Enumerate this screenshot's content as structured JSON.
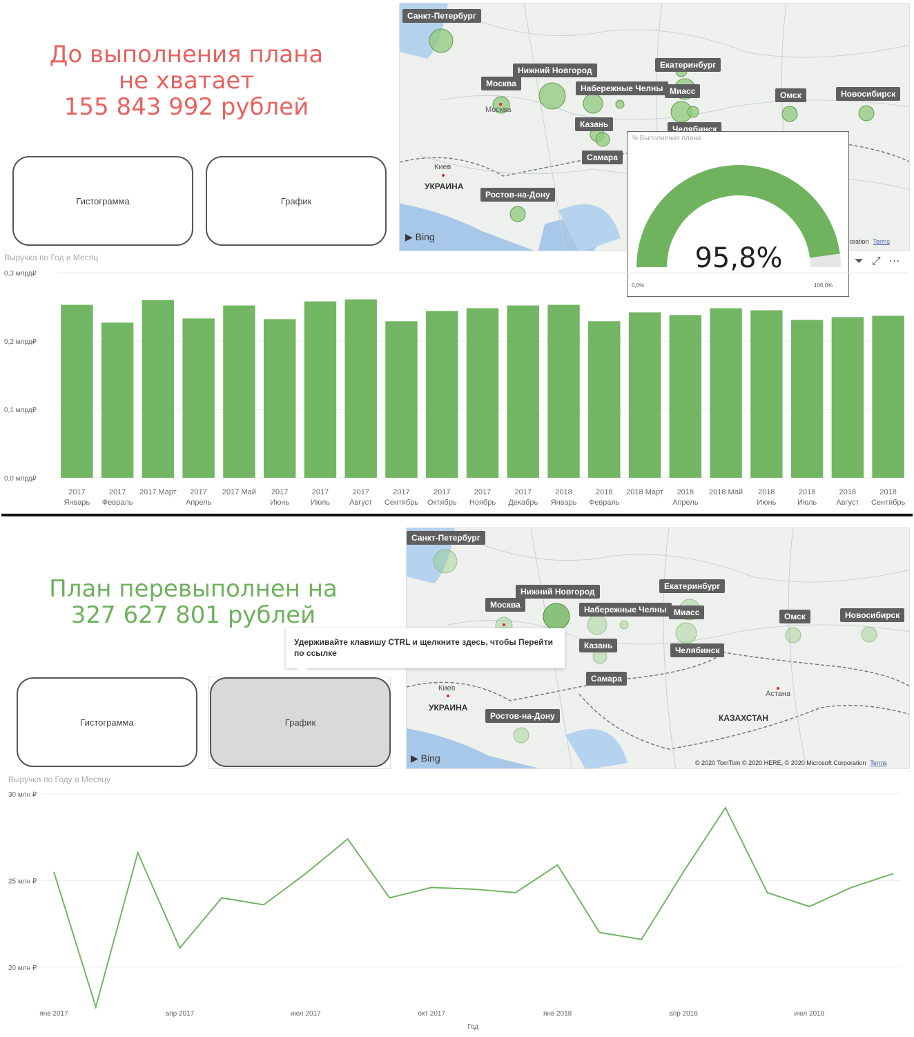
{
  "top": {
    "headline": "До выполнения плана\nне хватает\n    155 843 992 рублей",
    "buttons": [
      "Гистограмма",
      "График"
    ],
    "map": {
      "cities": [
        "Санкт-Петербург",
        "Москва",
        "Нижний Новгород",
        "Набережные Челны",
        "Екатеринбург",
        "Миасс",
        "Омск",
        "Новосибирск",
        "Казань",
        "Челябинск",
        "Самара",
        "Ростов-на-Дону"
      ],
      "country": "УКРАИНА",
      "places": [
        "Москва",
        "Киев"
      ],
      "bing": "Bing",
      "copyright": "oration",
      "terms": "Terms"
    },
    "gauge": {
      "title": "% Выполнения плана",
      "value_text": "95,8%",
      "fraction": 0.958,
      "min_label": "0,0%",
      "max_label": "100,0%",
      "fill_color": "#6fb35f",
      "track_color": "#e6e6e6"
    },
    "bar_chart": {
      "title": "Выручка по Год и Месяц",
      "chart_data": {
        "type": "bar",
        "ylim": [
          0,
          0.3
        ],
        "y_ticks": [
          0.0,
          0.1,
          0.2,
          0.3
        ],
        "y_tick_labels": [
          "0,0 млрд₽",
          "0,1 млрд₽",
          "0,2 млрд₽",
          "0,3 млрд₽"
        ],
        "categories": [
          [
            "2017",
            "Январь"
          ],
          [
            "2017",
            "Февраль"
          ],
          [
            "2017 Март",
            ""
          ],
          [
            "2017",
            "Апрель"
          ],
          [
            "2017 Май",
            ""
          ],
          [
            "2017",
            "Июнь"
          ],
          [
            "2017",
            "Июль"
          ],
          [
            "2017",
            "Август"
          ],
          [
            "2017",
            "Сентябрь"
          ],
          [
            "2017",
            "Октябрь"
          ],
          [
            "2017",
            "Ноябрь"
          ],
          [
            "2017",
            "Декабрь"
          ],
          [
            "2018",
            "Январь"
          ],
          [
            "2018",
            "Февраль"
          ],
          [
            "2018 Март",
            ""
          ],
          [
            "2018",
            "Апрель"
          ],
          [
            "2018 Май",
            ""
          ],
          [
            "2018",
            "Июнь"
          ],
          [
            "2018",
            "Июль"
          ],
          [
            "2018",
            "Август"
          ],
          [
            "2018",
            "Сентябрь"
          ]
        ],
        "values": [
          0.253,
          0.227,
          0.26,
          0.233,
          0.252,
          0.232,
          0.258,
          0.261,
          0.229,
          0.244,
          0.248,
          0.252,
          0.253,
          0.229,
          0.242,
          0.238,
          0.248,
          0.245,
          0.231,
          0.235,
          0.237
        ],
        "color": "#72b562"
      }
    }
  },
  "bottom": {
    "headline": "План перевыполнен на\n    327 627 801 рублей",
    "buttons": [
      "Гистограмма",
      "График"
    ],
    "tooltip": "Удерживайте клавишу CTRL и щелкните здесь, чтобы Перейти по ссылке",
    "map": {
      "cities": [
        "Санкт-Петербург",
        "Нижний Новгород",
        "Екатеринбург",
        "Москва",
        "Набережные Челны",
        "Миасс",
        "Омск",
        "Новосибирск",
        "Казань",
        "Челябинск",
        "Самара",
        "Ростов-на-Дону"
      ],
      "countries": [
        "УКРАИНА",
        "КАЗАХСТАН"
      ],
      "places": [
        "Киев",
        "Астана"
      ],
      "bing": "Bing",
      "copyright": "© 2020 TomTom © 2020 HERE, © 2020 Microsoft Corporation",
      "terms": "Terms"
    },
    "line_chart": {
      "title": "Выручка по Году и Месяцу",
      "chart_data": {
        "type": "line",
        "xlabel": "Год",
        "ylim": [
          20,
          30
        ],
        "y_ticks": [
          20,
          25,
          30
        ],
        "y_tick_labels": [
          "20 млн ₽",
          "25 млн ₽",
          "30 млн ₽"
        ],
        "x_tick_labels": [
          "янв 2017",
          "апр 2017",
          "июл 2017",
          "окт 2017",
          "янв 2018",
          "апр 2018",
          "июл 2018"
        ],
        "x_months": [
          "2017-01",
          "2017-02",
          "2017-03",
          "2017-04",
          "2017-05",
          "2017-06",
          "2017-07",
          "2017-08",
          "2017-09",
          "2017-10",
          "2017-11",
          "2017-12",
          "2018-01",
          "2018-02",
          "2018-03",
          "2018-04",
          "2018-05",
          "2018-06",
          "2018-07",
          "2018-08",
          "2018-09",
          "2018-10"
        ],
        "values": [
          25.5,
          17.7,
          26.6,
          21.1,
          24.0,
          23.6,
          25.4,
          27.4,
          24.0,
          24.6,
          24.5,
          24.3,
          25.9,
          22.0,
          21.6,
          25.5,
          29.2,
          24.3,
          23.5,
          24.6,
          25.4
        ],
        "color": "#72b562"
      }
    }
  }
}
